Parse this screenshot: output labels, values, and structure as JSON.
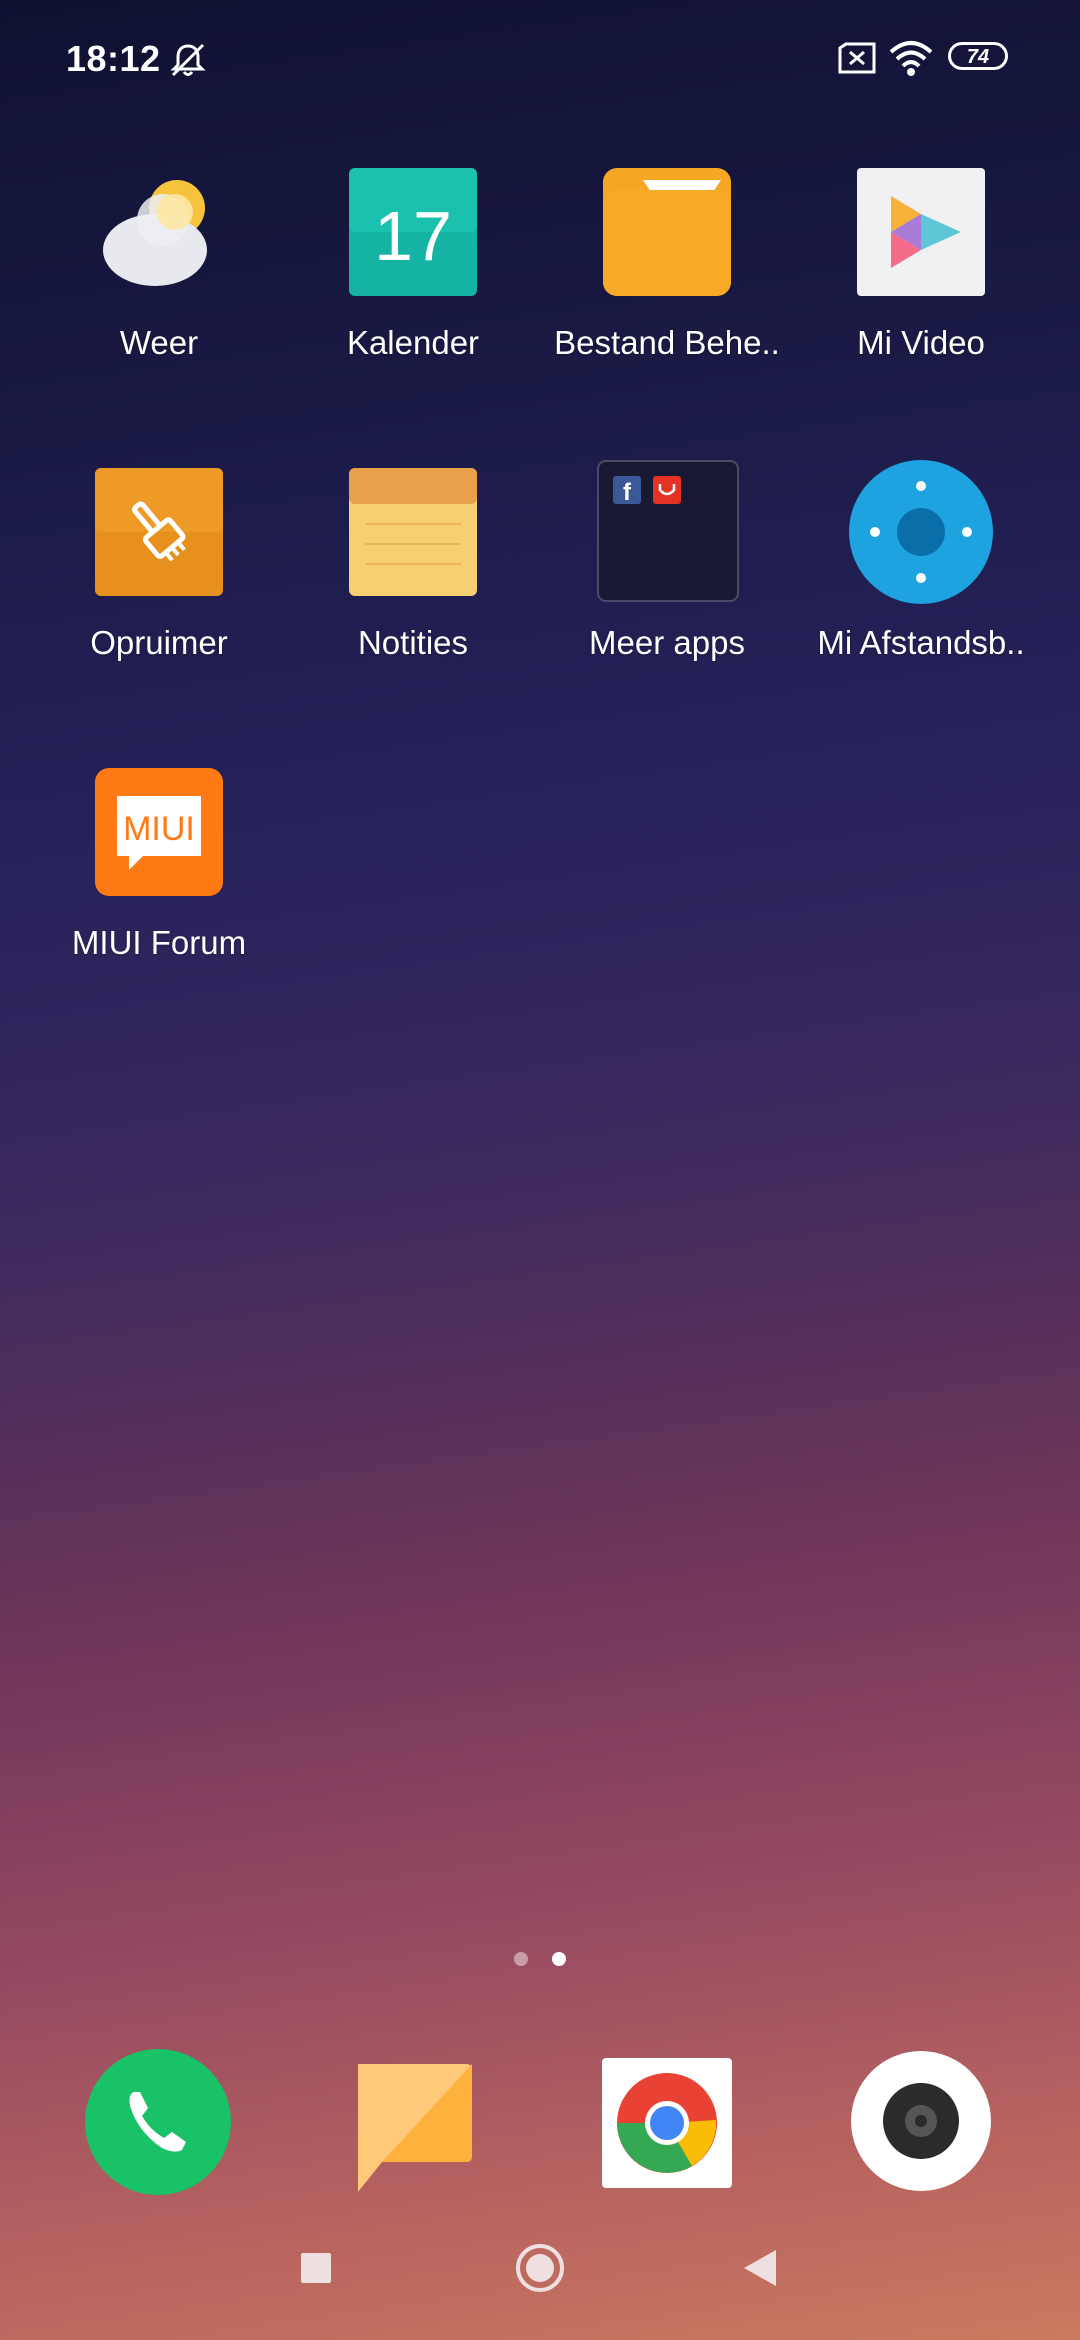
{
  "status_bar": {
    "time": "18:12",
    "battery_level": "74",
    "icons": [
      "bell-muted-icon",
      "sim-error-icon",
      "wifi-icon",
      "battery-icon"
    ]
  },
  "apps": [
    {
      "label": "Weer",
      "icon": "weather-icon"
    },
    {
      "label": "Kalender",
      "icon": "calendar-icon",
      "badge": "17"
    },
    {
      "label": "Bestand Behe..",
      "icon": "folder-icon"
    },
    {
      "label": "Mi Video",
      "icon": "video-play-icon"
    },
    {
      "label": "Opruimer",
      "icon": "broom-icon"
    },
    {
      "label": "Notities",
      "icon": "notes-icon"
    },
    {
      "label": "Meer apps",
      "icon": "folder-group-icon"
    },
    {
      "label": "Mi Afstandsb..",
      "icon": "remote-icon"
    },
    {
      "label": "MIUI Forum",
      "icon": "miui-forum-icon",
      "badge": "MIUI"
    }
  ],
  "pager": {
    "pages": 2,
    "current": 2
  },
  "dock": [
    {
      "name": "phone",
      "icon": "phone-icon"
    },
    {
      "name": "messages",
      "icon": "messages-icon"
    },
    {
      "name": "chrome",
      "icon": "chrome-icon"
    },
    {
      "name": "camera",
      "icon": "camera-icon"
    }
  ],
  "nav": [
    "recents-icon",
    "home-icon",
    "back-icon"
  ],
  "colors": {
    "calendar": "#14b3a3",
    "folder": "#f5a623",
    "cleaner": "#e8901e",
    "notes": "#f6cf72",
    "remote": "#1fa3e0",
    "miui": "#ff7a14",
    "phone": "#19c167"
  }
}
